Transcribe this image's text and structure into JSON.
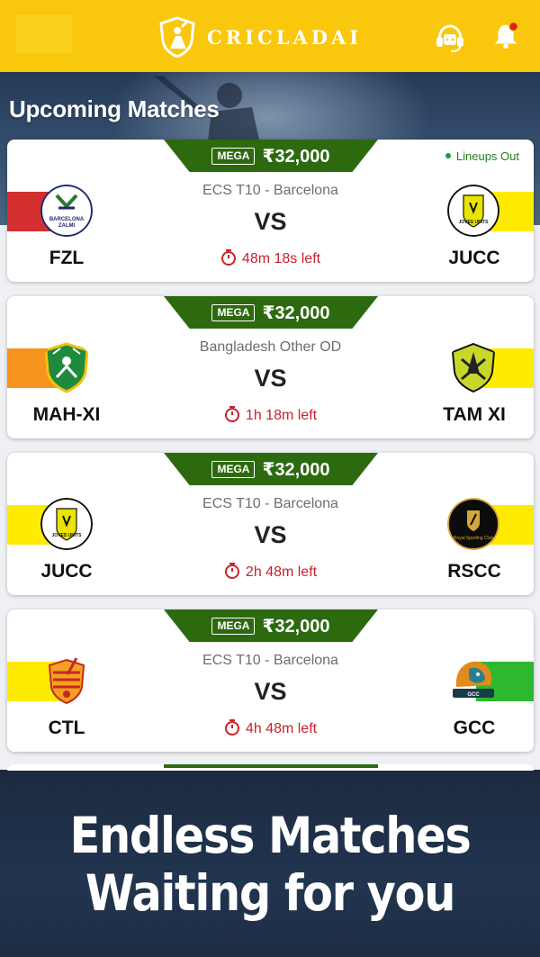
{
  "header": {
    "brand": "CRICLADAI",
    "logo_icon": "cricket-shield-icon",
    "support_icon": "headset-icon",
    "notification_icon": "bell-icon",
    "brand_color": "#f9c70c"
  },
  "section_title": "Upcoming Matches",
  "matches": [
    {
      "badge": "MEGA",
      "prize": "₹32,000",
      "lineups": "Lineups Out",
      "series": "ECS T10 - Barcelona",
      "vs": "VS",
      "time_left": "48m 18s left",
      "home": {
        "code": "FZL",
        "color": "#d32f2f",
        "logo": "barcelona-zalmi-falcons-logo"
      },
      "away": {
        "code": "JUCC",
        "color": "#ffeb00",
        "logo": "joves-units-logo"
      }
    },
    {
      "badge": "MEGA",
      "prize": "₹32,000",
      "lineups": "",
      "series": "Bangladesh Other OD",
      "vs": "VS",
      "time_left": "1h 18m left",
      "home": {
        "code": "MAH-XI",
        "color": "#f7941d",
        "logo": "mah-xi-logo"
      },
      "away": {
        "code": "TAM XI",
        "color": "#ffeb00",
        "logo": "tam-xi-logo"
      }
    },
    {
      "badge": "MEGA",
      "prize": "₹32,000",
      "lineups": "",
      "series": "ECS T10 - Barcelona",
      "vs": "VS",
      "time_left": "2h 48m left",
      "home": {
        "code": "JUCC",
        "color": "#ffeb00",
        "logo": "joves-units-logo"
      },
      "away": {
        "code": "RSCC",
        "color": "#ffeb00",
        "logo": "royal-sporting-club-logo"
      }
    },
    {
      "badge": "MEGA",
      "prize": "₹32,000",
      "lineups": "",
      "series": "ECS T10 - Barcelona",
      "vs": "VS",
      "time_left": "4h 48m left",
      "home": {
        "code": "CTL",
        "color": "#ffeb00",
        "logo": "ctl-logo"
      },
      "away": {
        "code": "GCC",
        "color": "#2eb82e",
        "logo": "gcc-lion-logo"
      }
    }
  ],
  "promo": {
    "line1": "Endless Matches",
    "line2": "Waiting for you"
  }
}
